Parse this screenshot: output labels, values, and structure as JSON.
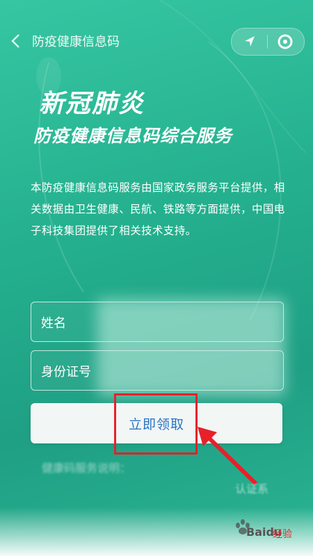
{
  "nav": {
    "title": "防疫健康信息码"
  },
  "hero": {
    "title": "新冠肺炎",
    "subtitle": "防疫健康信息码综合服务"
  },
  "description": "本防疫健康信息码服务由国家政务服务平台提供，相关数据由卫生健康、民航、铁路等方面提供，中国电子科技集团提供了相关技术支持。",
  "form": {
    "name_label": "姓名",
    "id_label": "身份证号",
    "submit_label": "立即领取"
  },
  "notes": {
    "line1": "健康码服务说明：",
    "line2": "认证系"
  },
  "watermark": {
    "text": "Baidu",
    "sub": "经验"
  },
  "colors": {
    "background": "#24b08e",
    "button_text": "#2a74c4",
    "highlight": "#e8202a"
  },
  "icons": {
    "back": "chevron-left-icon",
    "location": "location-arrow-icon",
    "close": "target-circle-icon"
  }
}
